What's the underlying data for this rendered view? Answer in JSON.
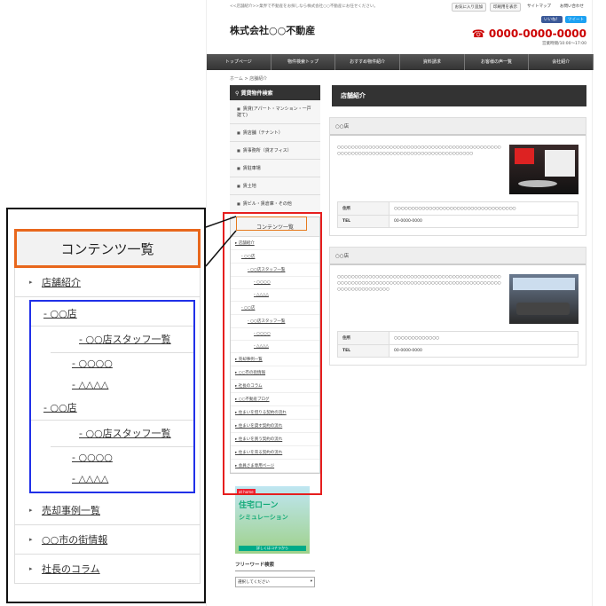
{
  "site": {
    "tagline": "<<店舗紹介>>業界で不動産をお探しなら株式会社○○不動産にお任せください。",
    "util": [
      "お気に入り追加",
      "印刷用を表示",
      "サイトマップ",
      "お問い合わせ"
    ],
    "social": [
      "いいね！",
      "ツイート"
    ],
    "logo": "株式会社○○不動産",
    "phone": "0000-0000-0000",
    "phone_hours": "営業時間/10:00〜17:00",
    "nav": [
      "トップページ",
      "物件検索トップ",
      "おすすめ物件紹介",
      "資料請求",
      "お客様の声一覧",
      "会社紹介"
    ],
    "breadcrumb": "ホーム  >  店舗紹介",
    "colors": {
      "nav": "#333333",
      "highlight_red": "#e61e1e",
      "highlight_orange": "#e8671c",
      "highlight_blue": "#2030e8",
      "phone": "#cc0000"
    }
  },
  "sidebar": {
    "search_title": "賃貸物件検索",
    "categories": [
      "賃貸(アパート・マンション・一戸建て)",
      "賃店舗（テナント）",
      "賃事務所（貸オフィス）",
      "賃駐車場",
      "賃土地",
      "賃ビル・賃倉庫・その他"
    ],
    "contents_title": "コンテンツ一覧",
    "contents": [
      {
        "label": "店舗紹介",
        "level": 0
      },
      {
        "label": "○○店",
        "level": 1
      },
      {
        "label": "○○店スタッフ一覧",
        "level": 2
      },
      {
        "label": "○○○○",
        "level": 3
      },
      {
        "label": "△△△△",
        "level": 3
      },
      {
        "label": "○○店",
        "level": 1
      },
      {
        "label": "○○店スタッフ一覧",
        "level": 2
      },
      {
        "label": "○○○○",
        "level": 3
      },
      {
        "label": "△△△△",
        "level": 3
      },
      {
        "label": "売却事例一覧",
        "level": 0
      },
      {
        "label": "○○市の街情報",
        "level": 0
      },
      {
        "label": "社長のコラム",
        "level": 0
      },
      {
        "label": "○○不動産ブログ",
        "level": 0
      },
      {
        "label": "住まいを借りる契約の流れ",
        "level": 0
      },
      {
        "label": "住まいを貸す契約の流れ",
        "level": 0
      },
      {
        "label": "住まいを買う契約の流れ",
        "level": 0
      },
      {
        "label": "住まいを売る契約の流れ",
        "level": 0
      },
      {
        "label": "会員さま専用ページ",
        "level": 0
      }
    ],
    "banner": {
      "brand": "at home",
      "line1": "住宅ローン",
      "line2": "シミュレーション",
      "cta": "詳しくはコチラから"
    },
    "freeword_title": "フリーワード検索",
    "freeword_select": "選択してください"
  },
  "main": {
    "title": "店舗紹介",
    "stores": [
      {
        "name": "○○店",
        "text": "○○○○○○○○○○○○○○○○○○○○○○○○○○○○○○○○○○○○○○○○○○○○○○○○○○○○○○○○○○○○○○○○○○○○○○○○○○○○○○○○○○○○○○",
        "address_label": "住所",
        "address": "○○○○○○○○○○○○○○○○○○○○○○○○○○○○○○○○○○○",
        "tel_label": "TEL",
        "tel": "00-0000-0000"
      },
      {
        "name": "○○店",
        "text": "○○○○○○○○○○○○○○○○○○○○○○○○○○○○○○○○○○○○○○○○○○○○○○○○○○○○○○○○○○○○○○○○○○○○○○○○○○○○○○○○○○○○○○○○○○○○○○○○○○○○○○○○○○○○○",
        "address_label": "住所",
        "address": "○○○○○○○○○○○○○",
        "tel_label": "TEL",
        "tel": "00-0000-0000"
      }
    ]
  },
  "zoom": {
    "title": "コンテンツ一覧",
    "top_items": [
      "店舗紹介"
    ],
    "group": [
      {
        "store": "○○店",
        "staff": "○○店スタッフ一覧",
        "members": [
          "○○○○",
          "△△△△"
        ]
      },
      {
        "store": "○○店",
        "staff": "○○店スタッフ一覧",
        "members": [
          "○○○○",
          "△△△△"
        ]
      }
    ],
    "bottom_items": [
      "売却事例一覧",
      "○○市の街情報",
      "社長のコラム"
    ]
  }
}
